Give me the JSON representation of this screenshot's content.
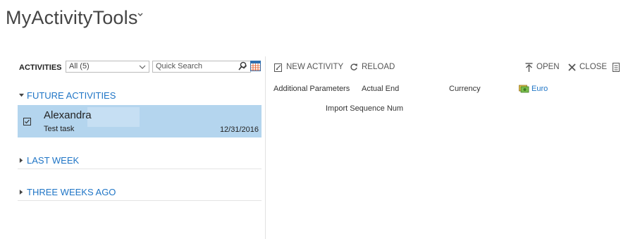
{
  "page": {
    "title": "MyActivityTools",
    "title_chevron_icon": "chevron-down-icon"
  },
  "left_pane": {
    "activities_label": "ACTIVITIES",
    "view_selector": {
      "value": "All (5)",
      "icon": "chevron-down-icon"
    },
    "quick_search": {
      "placeholder": "Quick Search",
      "icon": "chevron-down-icon"
    },
    "search_icon": "search-icon",
    "calendar_icon": "calendar-icon",
    "sections": [
      {
        "label": "FUTURE ACTIVITIES",
        "expanded": true,
        "items": [
          {
            "name": "Alexandra",
            "subject": "Test task",
            "date": "12/31/2016",
            "icon": "task-icon"
          }
        ]
      },
      {
        "label": "LAST WEEK",
        "expanded": false,
        "items": []
      },
      {
        "label": "THREE WEEKS AGO",
        "expanded": false,
        "items": []
      }
    ]
  },
  "toolbar": {
    "new_activity": {
      "label": "NEW ACTIVITY",
      "icon": "new-activity-icon"
    },
    "reload": {
      "label": "RELOAD",
      "icon": "reload-icon"
    },
    "open": {
      "label": "OPEN",
      "icon": "open-icon"
    },
    "close": {
      "label": "CLOSE",
      "icon": "close-icon"
    },
    "overflow_icon": "document-icon"
  },
  "fields": {
    "additional_parameters": "Additional Parameters",
    "actual_end": "Actual End",
    "currency": "Currency",
    "currency_value": "Euro",
    "currency_icon": "currency-icon",
    "import_sequence": "Import Sequence Num"
  },
  "colors": {
    "accent": "#1f75c6",
    "selected_row": "#b4d5ee",
    "text": "#444444"
  }
}
